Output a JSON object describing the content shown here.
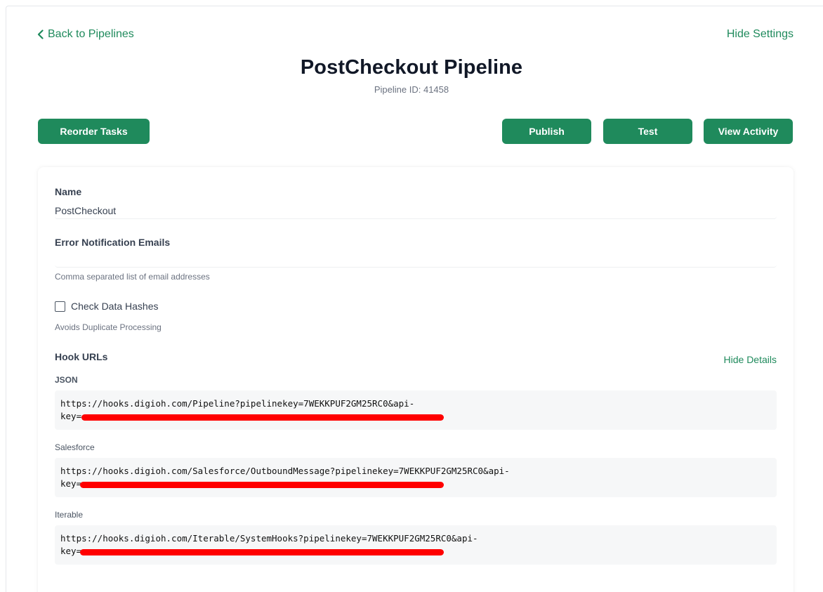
{
  "header": {
    "back_label": "Back to Pipelines",
    "hide_settings_label": "Hide Settings",
    "title": "PostCheckout Pipeline",
    "pipeline_id_text": "Pipeline ID: 41458"
  },
  "toolbar": {
    "reorder_label": "Reorder Tasks",
    "publish_label": "Publish",
    "test_label": "Test",
    "view_activity_label": "View Activity"
  },
  "form": {
    "name_label": "Name",
    "name_value": "PostCheckout",
    "error_emails_label": "Error Notification Emails",
    "error_emails_value": "",
    "error_emails_help": "Comma separated list of email addresses",
    "check_hashes_label": "Check Data Hashes",
    "check_hashes_checked": false,
    "check_hashes_help": "Avoids Duplicate Processing"
  },
  "hooks": {
    "section_label": "Hook URLs",
    "hide_details_label": "Hide Details",
    "items": [
      {
        "label": "JSON",
        "url_line1": "https://hooks.digioh.com/Pipeline?pipelinekey=7WEKKPUF2GM25RC0&api-",
        "url_line2": "key="
      },
      {
        "label": "Salesforce",
        "url_line1": "https://hooks.digioh.com/Salesforce/OutboundMessage?pipelinekey=7WEKKPUF2GM25RC0&api-",
        "url_line2": "key="
      },
      {
        "label": "Iterable",
        "url_line1": "https://hooks.digioh.com/Iterable/SystemHooks?pipelinekey=7WEKKPUF2GM25RC0&api-",
        "url_line2": "key="
      }
    ]
  },
  "colors": {
    "accent": "#1f8a5c",
    "redaction": "#ff0000"
  },
  "icons": {
    "back": "chevron-left-icon"
  }
}
